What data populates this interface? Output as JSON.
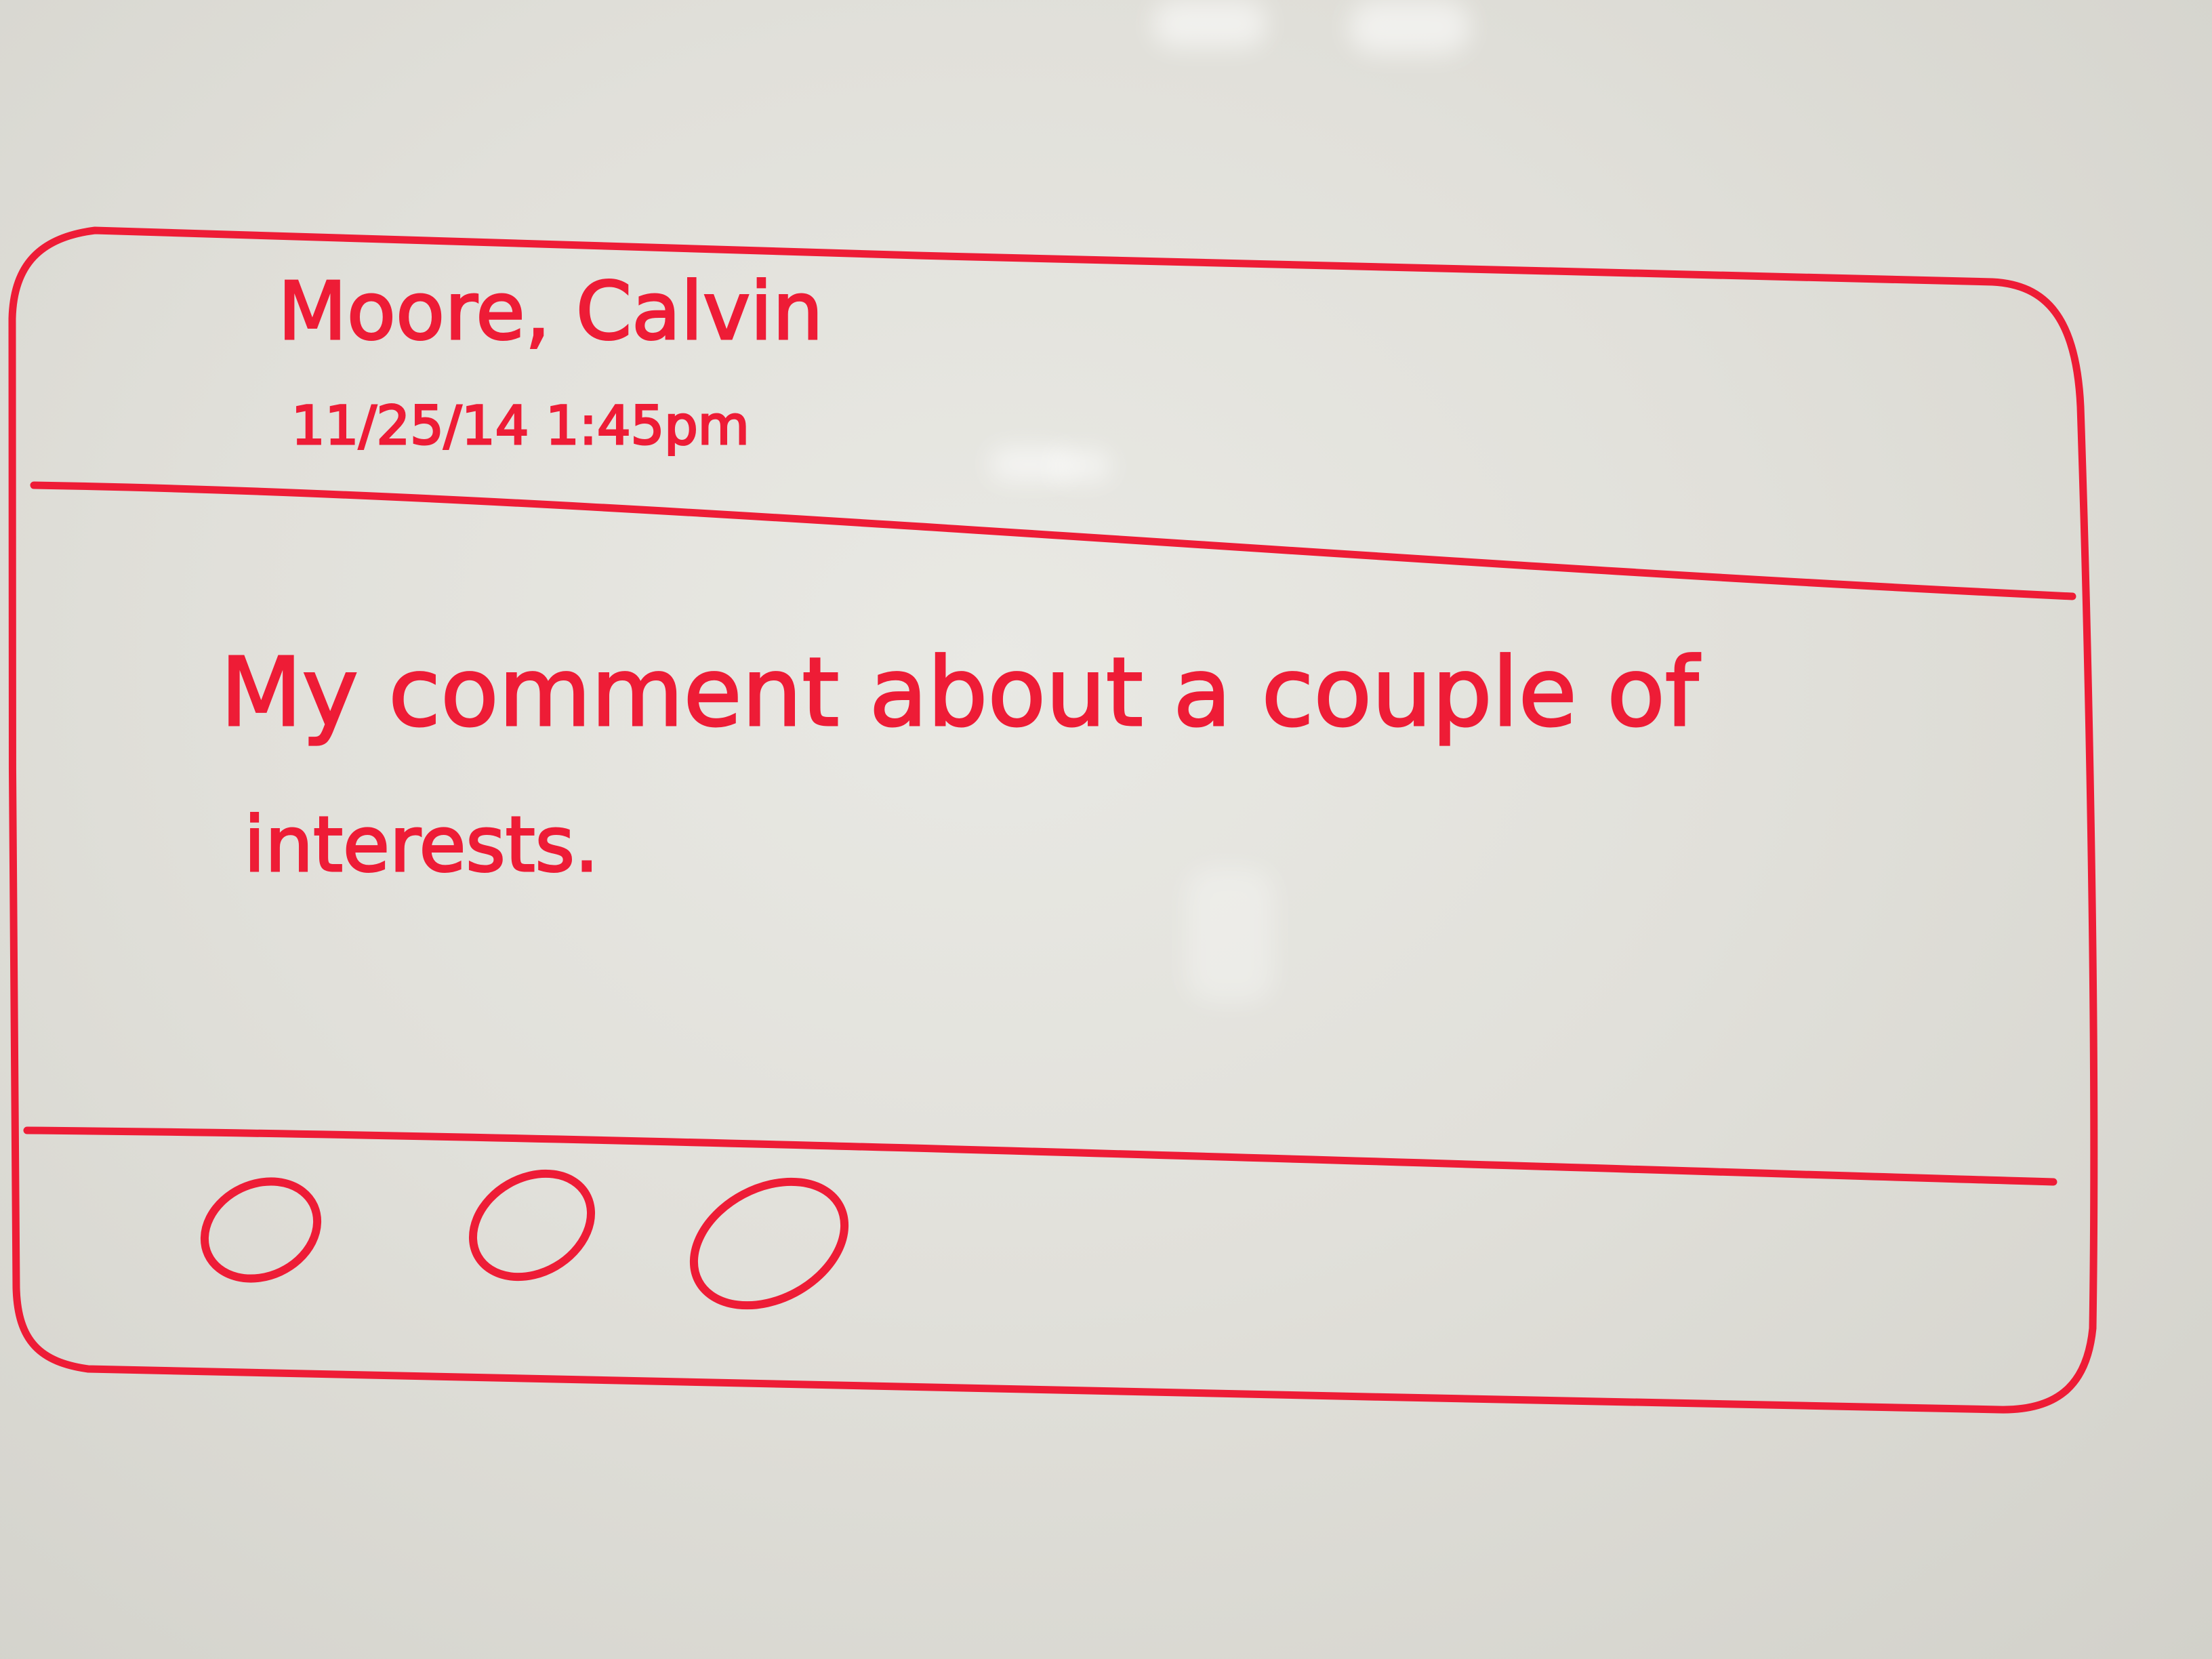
{
  "card": {
    "author_name": "Moore, Calvin",
    "timestamp": "11/25/14 1:45pm",
    "comment_line_1": "My comment about a couple of",
    "comment_line_2": "interests."
  },
  "footer": {
    "action_buttons": [
      "circle",
      "circle",
      "circle"
    ]
  },
  "colors": {
    "marker": "#ee1c36",
    "board": "#e3e2dc"
  }
}
